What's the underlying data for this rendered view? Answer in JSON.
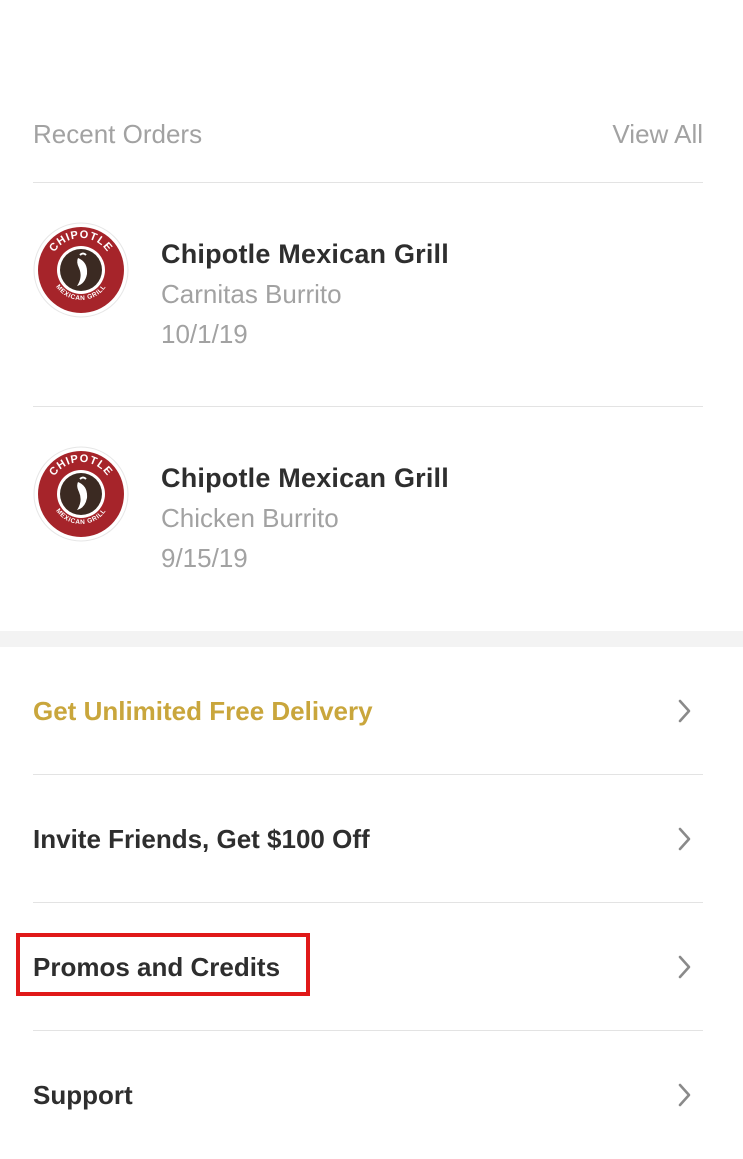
{
  "recent_orders": {
    "title": "Recent Orders",
    "view_all_label": "View All",
    "orders": [
      {
        "restaurant": "Chipotle Mexican Grill",
        "item": "Carnitas Burrito",
        "date": "10/1/19"
      },
      {
        "restaurant": "Chipotle Mexican Grill",
        "item": "Chicken Burrito",
        "date": "9/15/19"
      }
    ],
    "logo_text_top": "CHIPOTLE",
    "logo_text_bottom": "MEXICAN GRILL"
  },
  "menu": {
    "items": [
      {
        "label": "Get Unlimited Free Delivery",
        "icon": "chevron-right-icon"
      },
      {
        "label": "Invite Friends, Get $100 Off",
        "icon": "chevron-right-icon"
      },
      {
        "label": "Promos and Credits",
        "icon": "chevron-right-icon"
      },
      {
        "label": "Support",
        "icon": "chevron-right-icon"
      }
    ]
  },
  "colors": {
    "accent_gold": "#c9a63c",
    "highlight_red": "#e01919",
    "logo_red": "#a6242a",
    "muted_text": "#a2a2a2",
    "primary_text": "#2e2e2e"
  }
}
